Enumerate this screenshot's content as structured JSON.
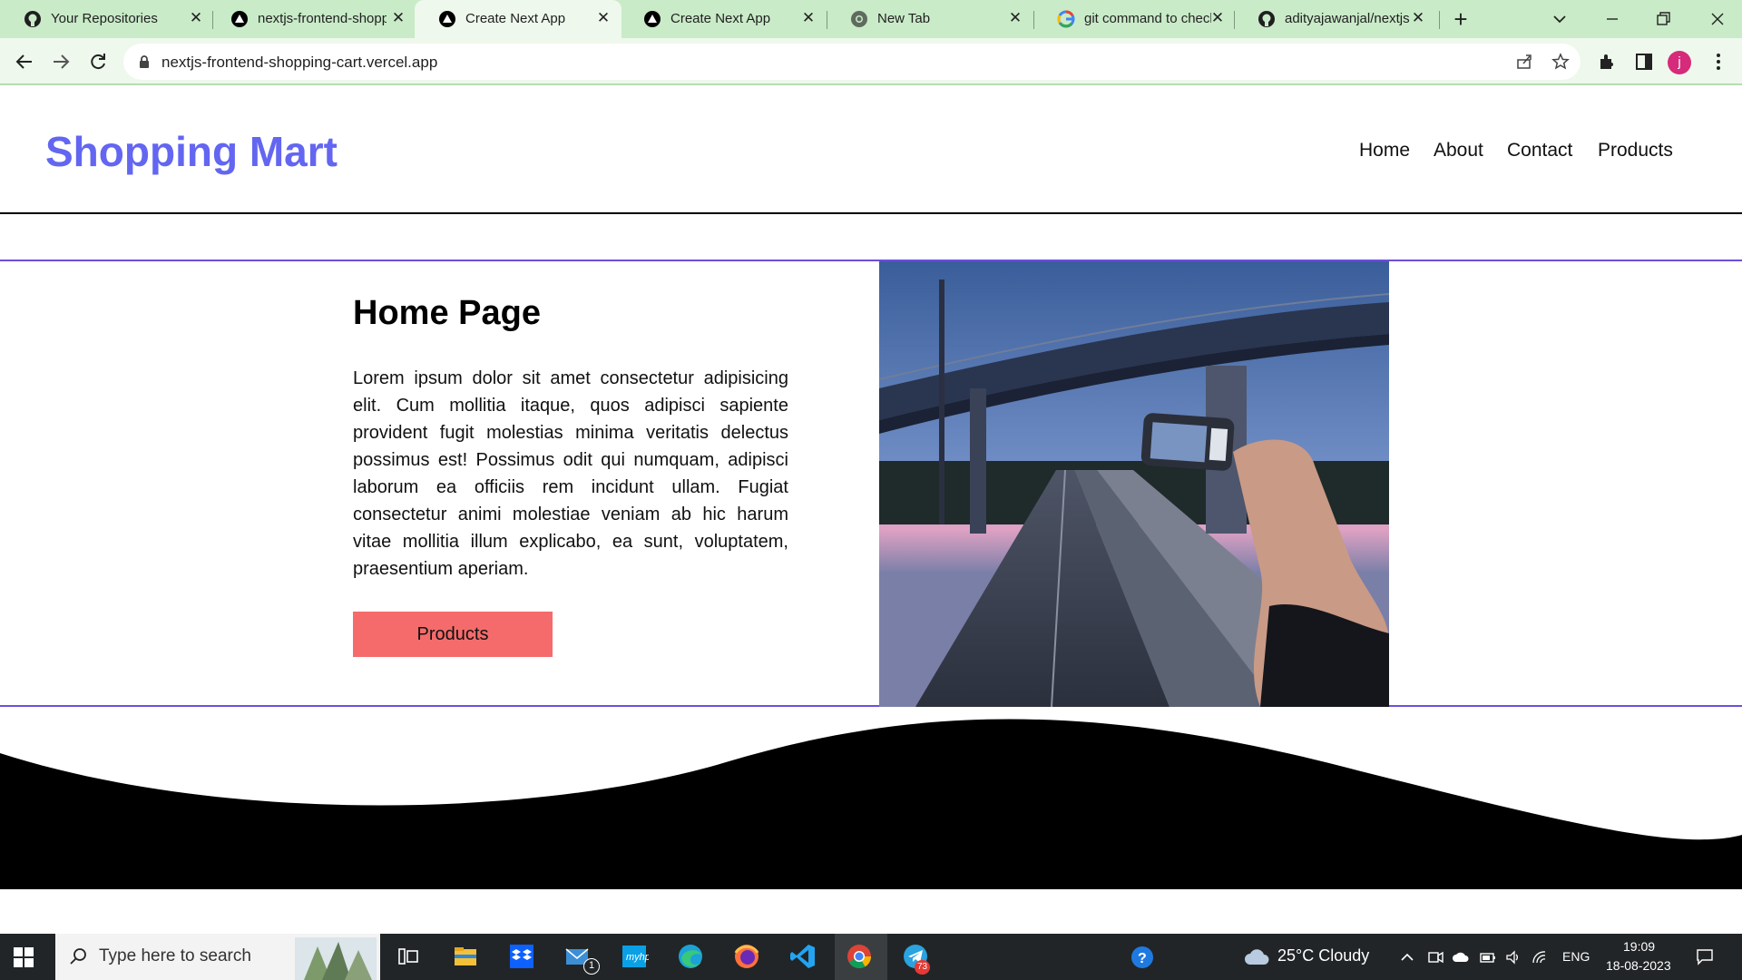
{
  "browser": {
    "tabs": [
      {
        "title": "Your Repositories",
        "favicon": "github-icon",
        "active": false
      },
      {
        "title": "nextjs-frontend-shopping-cart",
        "favicon": "vercel-icon",
        "active": false
      },
      {
        "title": "Create Next App",
        "favicon": "vercel-icon",
        "active": true
      },
      {
        "title": "Create Next App",
        "favicon": "vercel-icon",
        "active": false
      },
      {
        "title": "New Tab",
        "favicon": "chrome-icon",
        "active": false
      },
      {
        "title": "git command to check",
        "favicon": "google-icon",
        "active": false
      },
      {
        "title": "adityajawanjal/nextjs",
        "favicon": "github-icon",
        "active": false
      }
    ],
    "url": "nextjs-frontend-shopping-cart.vercel.app",
    "profile_initial": "j"
  },
  "site": {
    "brand": "Shopping Mart",
    "brand_color": "#6366f1",
    "nav": [
      "Home",
      "About",
      "Contact",
      "Products"
    ],
    "hero": {
      "title": "Home Page",
      "text": "Lorem ipsum dolor sit amet consectetur adipisicing elit. Cum mollitia itaque, quos adipisci sapiente provident fugit molestias minima veritatis delectus possimus est! Possimus odit qui numquam, adipisci laborum ea officiis rem incidunt ullam. Fugiat consectetur animi molestiae veniam ab hic harum vitae mollitia illum explicabo, ea sunt, voluptatem, praesentium aperiam.",
      "button_label": "Products",
      "button_color": "#f56b6b",
      "image": "photo of hand holding phone camera on bridge road at dusk"
    }
  },
  "taskbar": {
    "search_placeholder": "Type here to search",
    "apps": [
      "task-view-icon",
      "file-explorer-icon",
      "dropbox-icon",
      "mail-icon",
      "hp-icon",
      "edge-icon",
      "firefox-icon",
      "vscode-icon",
      "chrome-icon",
      "telegram-icon"
    ],
    "mail_badge": "1",
    "telegram_badge": "73",
    "weather": "25°C  Cloudy",
    "language": "ENG",
    "time": "19:09",
    "date": "18-08-2023"
  }
}
